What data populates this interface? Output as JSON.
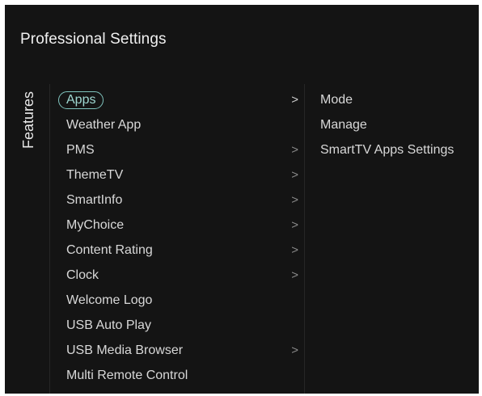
{
  "title": "Professional Settings",
  "side_label": "Features",
  "menu": {
    "items": [
      {
        "label": "Apps",
        "chevron": ">",
        "selected": true
      },
      {
        "label": "Weather App",
        "chevron": ""
      },
      {
        "label": "PMS",
        "chevron": ">"
      },
      {
        "label": "ThemeTV",
        "chevron": ">"
      },
      {
        "label": "SmartInfo",
        "chevron": ">"
      },
      {
        "label": "MyChoice",
        "chevron": ">"
      },
      {
        "label": "Content Rating",
        "chevron": ">"
      },
      {
        "label": "Clock",
        "chevron": ">"
      },
      {
        "label": "Welcome Logo",
        "chevron": ""
      },
      {
        "label": "USB Auto Play",
        "chevron": ""
      },
      {
        "label": "USB Media Browser",
        "chevron": ">"
      },
      {
        "label": "Multi Remote Control",
        "chevron": ""
      }
    ]
  },
  "submenu": {
    "items": [
      {
        "label": "Mode"
      },
      {
        "label": "Manage"
      },
      {
        "label": "SmartTV Apps Settings"
      }
    ]
  },
  "colors": {
    "background": "#141414",
    "text": "#d8d8d8",
    "accent": "#7fc3bd"
  }
}
